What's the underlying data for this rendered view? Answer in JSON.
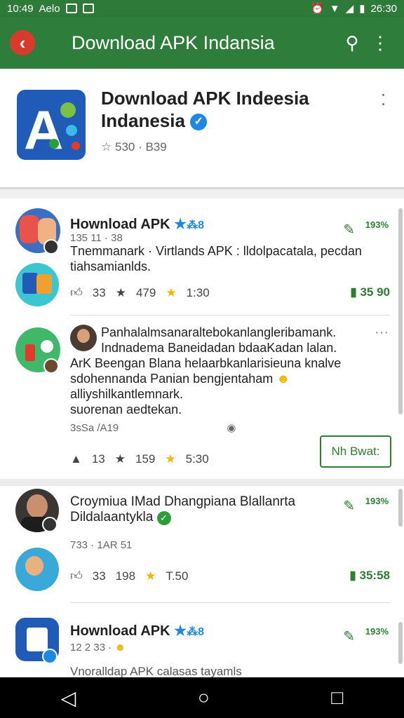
{
  "status_bar": {
    "time": "10:49",
    "carrier": "Aelo",
    "right_text": "26:30"
  },
  "app_bar": {
    "title": "Download APK Indansia",
    "back_icon": "back-arrow-icon",
    "search_icon": "search-icon",
    "more_icon": "more-vert-icon"
  },
  "app_header": {
    "name_line1": "Download APK Indeesia",
    "name_line2": "Indanesia",
    "meta": "530 · B39"
  },
  "posts": [
    {
      "title": "Hownload APK",
      "title_suffix": "⁂8",
      "sub": "135 11 · 38",
      "text1": "Tnemmanark · Virtlands APK : lldolpacatala, pecdan",
      "text2": "tiahsamianlds.",
      "stat1": "33",
      "stat2": "479",
      "stat3": "1:30",
      "right_value": "35 90",
      "pct": "193%"
    },
    {
      "line1": "Panhalalmsanaraltebokanlangleribamank.",
      "line2": "Indnadema Baneidadan bdaaKadan lalan.",
      "line3": "ArK  Beengan Blana helaarbkanlarisieuna knalve",
      "line4": "sdohennanda Panian bengjentaham",
      "line5": "alliyshilkantlemnark.",
      "line6": "suorenan aedtekan.",
      "sub": "3sSa /A19",
      "stat1": "13",
      "stat2": "159",
      "stat3": "5:30",
      "button": "Nh Bwat:"
    },
    {
      "title_line1": "Croymiua IMad Dhangpiana Blallanrta",
      "title_line2": "Dildalaantykla",
      "sub": "733 · 1AR 51",
      "stat1": "33",
      "stat2": "198",
      "stat3": "T.50",
      "right_value": "35:58",
      "pct": "193%"
    },
    {
      "title": "Hownload APK",
      "title_suffix": "⁂8",
      "sub": "12 2 33 ·",
      "text1": "Vnoralldap APK calasas tayamls",
      "pct": "193%"
    }
  ],
  "colors": {
    "app_bar": "#2f7d3a",
    "accent_green": "#2e7d32",
    "star": "#f4b400",
    "verified_blue": "#1e88e5"
  }
}
